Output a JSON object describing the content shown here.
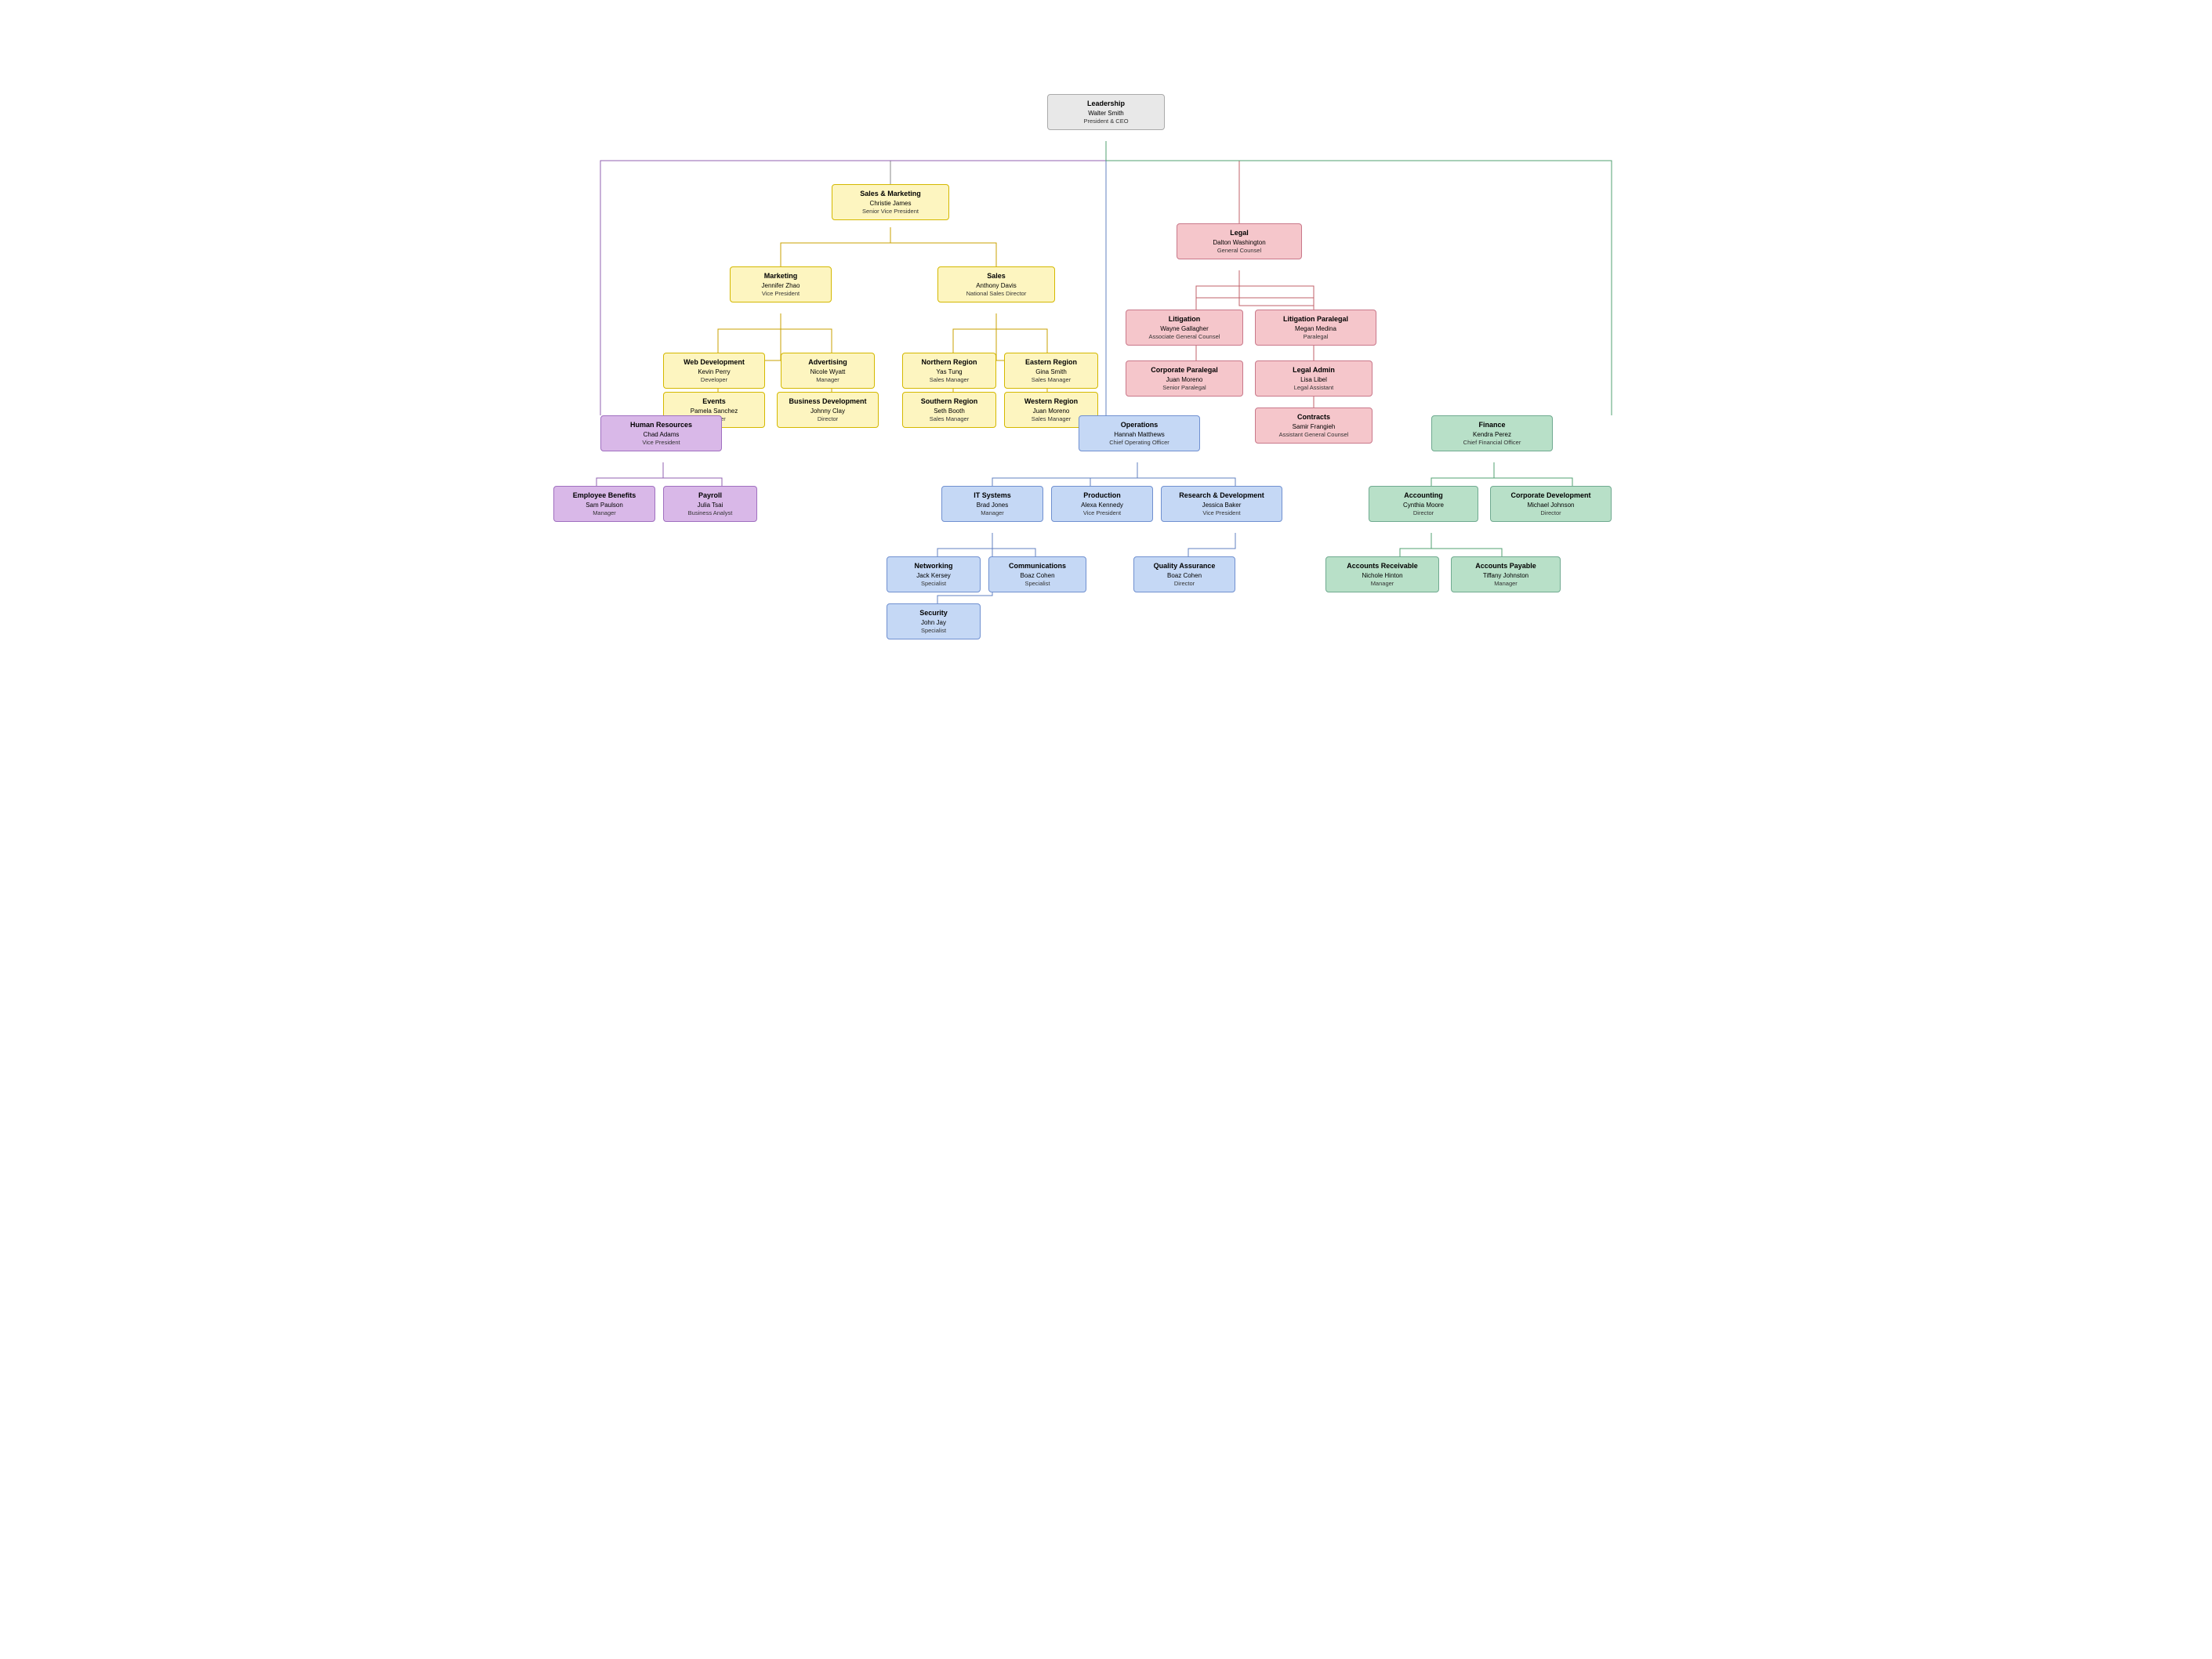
{
  "nodes": {
    "leadership": {
      "dept": "Leadership",
      "name": "Walter Smith",
      "title": "President & CEO"
    },
    "salesMarketing": {
      "dept": "Sales & Marketing",
      "name": "Christie James",
      "title": "Senior Vice President"
    },
    "marketing": {
      "dept": "Marketing",
      "name": "Jennifer Zhao",
      "title": "Vice President"
    },
    "sales": {
      "dept": "Sales",
      "name": "Anthony Davis",
      "title": "National Sales Director"
    },
    "webDev": {
      "dept": "Web Development",
      "name": "Kevin Perry",
      "title": "Developer"
    },
    "advertising": {
      "dept": "Advertising",
      "name": "Nicole Wyatt",
      "title": "Manager"
    },
    "northernRegion": {
      "dept": "Northern Region",
      "name": "Yas Tung",
      "title": "Sales Manager"
    },
    "easternRegion": {
      "dept": "Eastern Region",
      "name": "Gina Smith",
      "title": "Sales Manager"
    },
    "events": {
      "dept": "Events",
      "name": "Pamela Sanchez",
      "title": "Manager"
    },
    "bizDev": {
      "dept": "Business Development",
      "name": "Johnny Clay",
      "title": "Director"
    },
    "southernRegion": {
      "dept": "Southern Region",
      "name": "Seth Booth",
      "title": "Sales Manager"
    },
    "westernRegion": {
      "dept": "Western Region",
      "name": "Juan Moreno",
      "title": "Sales Manager"
    },
    "legal": {
      "dept": "Legal",
      "name": "Dalton Washington",
      "title": "General Counsel"
    },
    "litigation": {
      "dept": "Litigation",
      "name": "Wayne Gallagher",
      "title": "Associate General Counsel"
    },
    "litigationParalegal": {
      "dept": "Litigation Paralegal",
      "name": "Megan Medina",
      "title": "Paralegal"
    },
    "corporateParalegal": {
      "dept": "Corporate Paralegal",
      "name": "Juan Moreno",
      "title": "Senior Paralegal"
    },
    "legalAdmin": {
      "dept": "Legal Admin",
      "name": "Lisa Libel",
      "title": "Legal Assistant"
    },
    "contracts": {
      "dept": "Contracts",
      "name": "Samir Frangieh",
      "title": "Assistant General Counsel"
    },
    "humanResources": {
      "dept": "Human Resources",
      "name": "Chad Adams",
      "title": "Vice President"
    },
    "employeeBenefits": {
      "dept": "Employee Benefits",
      "name": "Sam Paulson",
      "title": "Manager"
    },
    "payroll": {
      "dept": "Payroll",
      "name": "Julia Tsai",
      "title": "Business Analyst"
    },
    "operations": {
      "dept": "Operations",
      "name": "Hannah Matthews",
      "title": "Chief Operating Officer"
    },
    "itSystems": {
      "dept": "IT Systems",
      "name": "Brad Jones",
      "title": "Manager"
    },
    "production": {
      "dept": "Production",
      "name": "Alexa Kennedy",
      "title": "Vice President"
    },
    "researchDev": {
      "dept": "Research & Development",
      "name": "Jessica Baker",
      "title": "Vice President"
    },
    "networking": {
      "dept": "Networking",
      "name": "Jack Kersey",
      "title": "Specialist"
    },
    "communications": {
      "dept": "Communications",
      "name": "Boaz Cohen",
      "title": "Specialist"
    },
    "qualityAssurance": {
      "dept": "Quality Assurance",
      "name": "Boaz Cohen",
      "title": "Director"
    },
    "security": {
      "dept": "Security",
      "name": "John Jay",
      "title": "Specialist"
    },
    "finance": {
      "dept": "Finance",
      "name": "Kendra Perez",
      "title": "Chief Financial Officer"
    },
    "accounting": {
      "dept": "Accounting",
      "name": "Cynthia Moore",
      "title": "Director"
    },
    "corpDev": {
      "dept": "Corporate Development",
      "name": "Michael Johnson",
      "title": "Director"
    },
    "accountsReceivable": {
      "dept": "Accounts Receivable",
      "name": "Nichole Hinton",
      "title": "Manager"
    },
    "accountsPayable": {
      "dept": "Accounts Payable",
      "name": "Tiffany Johnston",
      "title": "Manager"
    }
  }
}
